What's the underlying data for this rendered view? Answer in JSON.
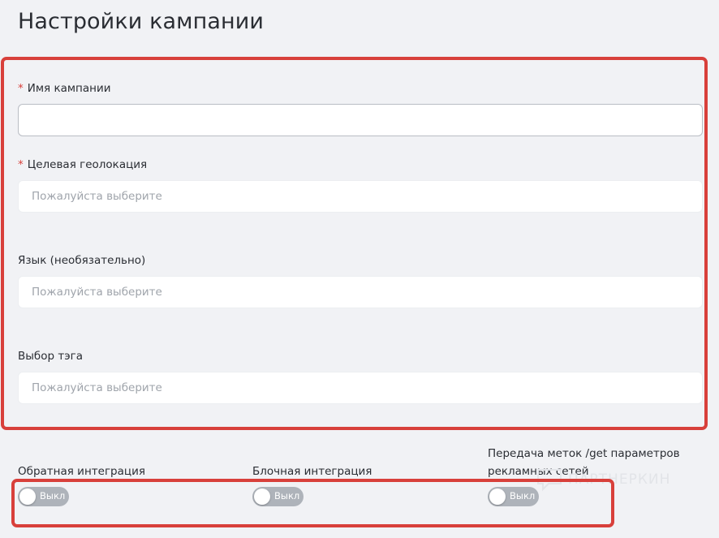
{
  "page": {
    "title": "Настройки кампании"
  },
  "form": {
    "campaign_name": {
      "label": "Имя кампании",
      "required": true,
      "value": "",
      "placeholder": ""
    },
    "geolocation": {
      "label": "Целевая геолокация",
      "required": true,
      "placeholder": "Пожалуйста выберите"
    },
    "language": {
      "label": "Язык (необязательно)",
      "required": false,
      "placeholder": "Пожалуйста выберите"
    },
    "tag": {
      "label": "Выбор тэга",
      "required": false,
      "placeholder": "Пожалуйста выберите"
    },
    "required_mark": "*"
  },
  "integrations": [
    {
      "label": "Обратная интеграция",
      "state": "Выкл",
      "enabled": false
    },
    {
      "label": "Блочная интеграция",
      "state": "Выкл",
      "enabled": false
    },
    {
      "label_line1": "Передача меток /get параметров",
      "label_line2": "рекламных сетей",
      "state": "Выкл",
      "enabled": false
    }
  ],
  "watermark": {
    "text": "ПАРТНЕРКИН"
  },
  "colors": {
    "accent_red": "#d8403b",
    "toggle_off": "#aeb3ba",
    "background": "#f1f2f5"
  }
}
